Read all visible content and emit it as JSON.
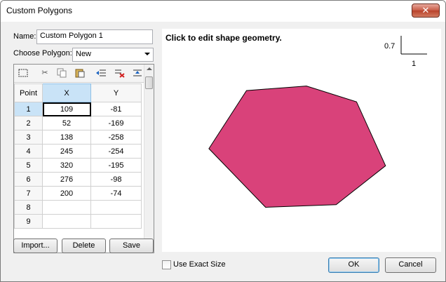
{
  "window": {
    "title": "Custom Polygons",
    "close_glyph": "✕"
  },
  "form": {
    "name_label": "Name:",
    "name_value": "Custom Polygon 1",
    "choose_label": "Choose Polygon:",
    "choose_value": "New"
  },
  "grid": {
    "headers": {
      "point": "Point",
      "x": "X",
      "y": "Y"
    },
    "rows": [
      {
        "point": "1",
        "x": "109",
        "y": "-81"
      },
      {
        "point": "2",
        "x": "52",
        "y": "-169"
      },
      {
        "point": "3",
        "x": "138",
        "y": "-258"
      },
      {
        "point": "4",
        "x": "245",
        "y": "-254"
      },
      {
        "point": "5",
        "x": "320",
        "y": "-195"
      },
      {
        "point": "6",
        "x": "276",
        "y": "-98"
      },
      {
        "point": "7",
        "x": "200",
        "y": "-74"
      },
      {
        "point": "8",
        "x": "",
        "y": ""
      },
      {
        "point": "9",
        "x": "",
        "y": ""
      }
    ],
    "toolbar_icons": [
      "select-icon",
      "cut-icon",
      "copy-icon",
      "paste-icon",
      "insert-row-icon",
      "delete-row-icon",
      "add-row-icon"
    ]
  },
  "buttons": {
    "import": "Import...",
    "delete": "Delete",
    "save": "Save",
    "ok": "OK",
    "cancel": "Cancel"
  },
  "canvas": {
    "hint": "Click to edit shape geometry.",
    "scale_y": "0.7",
    "scale_x": "1",
    "polygon_color": "#d9427a"
  },
  "options": {
    "exact_size_label": "Use Exact Size",
    "exact_size_checked": false
  }
}
